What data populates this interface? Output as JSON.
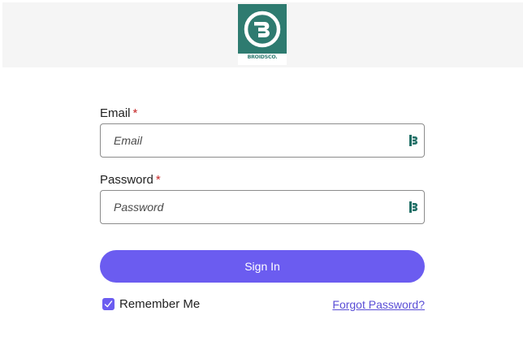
{
  "brand": {
    "name": "BROIDSCO.",
    "logo_icon": "broids-b-logo-icon",
    "color": "#2e7b70"
  },
  "form": {
    "email": {
      "label": "Email",
      "required_marker": "*",
      "placeholder": "Email",
      "value": "",
      "icon": "password-manager-icon"
    },
    "password": {
      "label": "Password",
      "required_marker": "*",
      "placeholder": "Password",
      "value": "",
      "icon": "password-manager-icon"
    },
    "submit_label": "Sign In",
    "remember": {
      "label": "Remember Me",
      "checked": true
    },
    "forgot_label": "Forgot Password?"
  },
  "colors": {
    "accent": "#6b5cf0",
    "link": "#5a4ed6",
    "required": "#c62828",
    "header_bg": "#f5f5f5"
  }
}
